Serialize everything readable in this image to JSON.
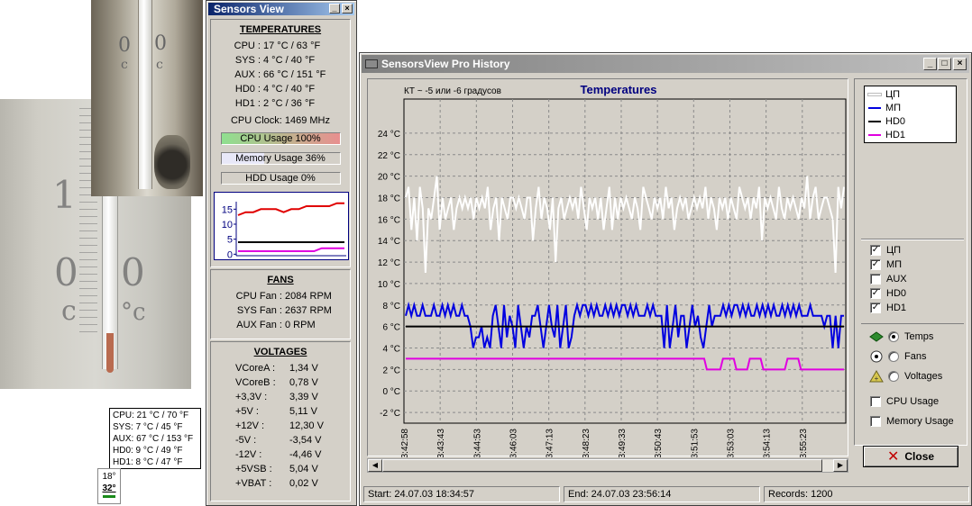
{
  "photos": {
    "left_digits": [
      "1",
      "0",
      "0",
      "c",
      "°c"
    ],
    "top_digits": [
      "0",
      "0",
      "c",
      "c"
    ]
  },
  "tray_tooltip": {
    "lines": [
      "CPU: 21 °C / 70 °F",
      "SYS: 7 °C / 45 °F",
      "AUX: 67 °C / 153 °F",
      "HD0: 9 °C / 49 °F",
      "HD1: 8 °C / 47 °F"
    ]
  },
  "tray_icon": {
    "top": "18°",
    "bottom": "32°"
  },
  "sensors_view": {
    "title": "Sensors View",
    "title_buttons": [
      "_",
      "×"
    ],
    "temperatures": {
      "heading": "TEMPERATURES",
      "rows": [
        {
          "label": "CPU :",
          "value": "17 °C / 63 °F"
        },
        {
          "label": "SYS :",
          "value": "4 °C / 40 °F"
        },
        {
          "label": "AUX :",
          "value": "66 °C / 151 °F"
        },
        {
          "label": "HD0 :",
          "value": "4 °C / 40 °F"
        },
        {
          "label": "HD1 :",
          "value": "2 °C / 36 °F"
        }
      ],
      "cpu_clock": "CPU Clock: 1469 MHz"
    },
    "usage": [
      {
        "label": "CPU Usage 100%",
        "fraction": 1.0,
        "fill": "linear-gradient(90deg,#8fe08f,#e88f8f)"
      },
      {
        "label": "Memory Usage 36%",
        "fraction": 0.36,
        "fill": "#e8e8f8"
      },
      {
        "label": "HDD Usage 0%",
        "fraction": 0.0,
        "fill": "#d4d0c8"
      }
    ],
    "mini_chart": {
      "y_ticks": [
        "15",
        "10",
        "5",
        "0"
      ],
      "series": [
        {
          "name": "CPU",
          "color": "#e00000",
          "values": [
            13,
            14,
            14,
            15,
            15,
            15,
            14,
            15,
            15,
            16,
            16,
            16,
            16,
            17,
            17
          ]
        },
        {
          "name": "HD0",
          "color": "#000000",
          "values": [
            4,
            4,
            4,
            4,
            4,
            4,
            4,
            4,
            4,
            4,
            4,
            4,
            4,
            4,
            4
          ]
        },
        {
          "name": "HD1",
          "color": "#e000e0",
          "values": [
            1,
            1,
            1,
            1,
            1,
            1,
            1,
            1,
            1,
            1,
            1,
            2,
            2,
            2,
            2
          ]
        }
      ]
    },
    "fans": {
      "heading": "FANS",
      "rows": [
        {
          "label": "CPU Fan :",
          "value": "2084 RPM"
        },
        {
          "label": "SYS Fan :",
          "value": "2637 RPM"
        },
        {
          "label": "AUX Fan :",
          "value": "0 RPM"
        }
      ]
    },
    "voltages": {
      "heading": "VOLTAGES",
      "rows": [
        {
          "label": "VCoreA :",
          "value": "1,34 V"
        },
        {
          "label": "VCoreB :",
          "value": "0,78 V"
        },
        {
          "label": "+3,3V :",
          "value": "3,39 V"
        },
        {
          "label": "+5V :",
          "value": "5,11 V"
        },
        {
          "label": "+12V :",
          "value": "12,30 V"
        },
        {
          "label": "-5V :",
          "value": "-3,54 V"
        },
        {
          "label": "-12V :",
          "value": "-4,46 V"
        },
        {
          "label": "+5VSB :",
          "value": "5,04 V"
        },
        {
          "label": "+VBAT :",
          "value": "0,02 V"
        }
      ]
    }
  },
  "history": {
    "title": "SensorsView Pro History",
    "title_buttons": [
      "_",
      "□",
      "×"
    ],
    "annotation": "КТ ~ -5 или -6 градусов",
    "legend": [
      {
        "name": "ЦП",
        "color": "#ffffff"
      },
      {
        "name": "МП",
        "color": "#0000e0"
      },
      {
        "name": "HD0",
        "color": "#000000"
      },
      {
        "name": "HD1",
        "color": "#e000e0"
      }
    ],
    "checkboxes": [
      {
        "label": "ЦП",
        "checked": true
      },
      {
        "label": "МП",
        "checked": true
      },
      {
        "label": "AUX",
        "checked": false
      },
      {
        "label": "HD0",
        "checked": true
      },
      {
        "label": "HD1",
        "checked": true
      }
    ],
    "radios": [
      {
        "label": "Temps",
        "selected": true,
        "icon": "temps-icon"
      },
      {
        "label": "Fans",
        "selected": false,
        "icon": "fan-icon"
      },
      {
        "label": "Voltages",
        "selected": false,
        "icon": "voltage-icon"
      }
    ],
    "extra_checkboxes": [
      {
        "label": "CPU Usage",
        "checked": false
      },
      {
        "label": "Memory Usage",
        "checked": false
      }
    ],
    "close_label": "Close",
    "status": {
      "start": "Start: 24.07.03 18:34:57",
      "end": "End: 24.07.03 23:56:14",
      "records": "Records: 1200"
    }
  },
  "chart_data": {
    "type": "line",
    "title": "Temperatures",
    "xlabel": "",
    "ylabel": "",
    "ylim": [
      -3,
      25
    ],
    "y_ticks": [
      24,
      22,
      20,
      18,
      16,
      14,
      12,
      10,
      8,
      6,
      4,
      2,
      0,
      -2
    ],
    "y_tick_labels": [
      "24 °C",
      "22 °C",
      "20 °C",
      "18 °C",
      "16 °C",
      "14 °C",
      "12 °C",
      "10 °C",
      "8 °C",
      "6 °C",
      "4 °C",
      "2 °C",
      "0 °C",
      "-2 °C"
    ],
    "x_tick_labels": [
      "23:42:58",
      "23:43:43",
      "23:44:53",
      "23:46:03",
      "23:47:13",
      "23:48:23",
      "23:49:33",
      "23:50:43",
      "23:51:53",
      "23:53:03",
      "23:54:13",
      "23:55:23"
    ],
    "grid": true,
    "background": "#d4d0c8",
    "series": [
      {
        "name": "ЦП",
        "color": "#ffffff",
        "values": [
          18,
          19,
          15,
          18,
          14,
          19,
          17,
          11,
          17,
          16,
          18,
          20,
          15,
          18,
          16,
          17,
          18,
          15,
          17,
          18,
          17,
          18,
          17,
          18,
          16,
          18,
          17,
          18,
          17,
          19,
          15,
          17,
          18,
          14,
          18,
          17,
          16,
          18,
          18,
          17,
          18,
          17,
          16,
          18,
          18,
          14,
          17,
          19,
          16,
          18,
          17,
          15,
          18,
          12,
          17,
          18,
          16,
          17,
          18,
          17,
          18,
          16,
          19,
          17,
          15,
          18,
          17,
          18,
          16,
          18,
          15,
          17,
          19,
          15,
          18,
          16,
          18,
          17,
          18,
          17,
          16,
          18,
          17,
          15,
          19,
          18,
          17,
          16,
          18,
          17,
          18,
          16,
          19,
          17,
          18,
          15,
          17,
          18,
          17,
          18,
          16,
          17,
          18,
          17,
          18,
          17,
          19,
          16,
          18,
          17,
          15,
          18,
          17,
          18,
          16,
          18,
          17,
          16,
          19,
          18,
          17,
          18,
          16,
          18,
          17,
          19,
          14,
          18,
          17,
          18,
          17,
          16,
          19,
          17,
          16,
          18,
          17,
          18,
          17,
          16,
          18,
          17,
          20,
          16,
          18,
          19,
          16,
          17,
          18,
          18,
          17,
          16,
          11,
          19,
          17,
          19
        ]
      },
      {
        "name": "МП",
        "color": "#0000e0",
        "values": [
          7,
          8,
          7,
          8,
          7,
          7,
          8,
          7,
          7,
          7,
          8,
          7,
          7,
          8,
          7,
          8,
          7,
          8,
          7,
          7,
          8,
          7,
          7,
          6,
          4,
          5,
          5,
          6,
          4,
          5,
          4,
          7,
          8,
          6,
          4,
          8,
          5,
          7,
          6,
          4,
          8,
          6,
          4,
          6,
          5,
          7,
          7,
          8,
          6,
          4,
          6,
          8,
          6,
          5,
          8,
          4,
          6,
          8,
          4,
          5,
          7,
          8,
          7,
          8,
          8,
          7,
          8,
          7,
          8,
          7,
          7,
          8,
          7,
          8,
          7,
          8,
          7,
          8,
          8,
          7,
          8,
          7,
          8,
          7,
          7,
          7,
          8,
          7,
          8,
          7,
          7,
          7,
          4,
          8,
          4,
          6,
          8,
          5,
          7,
          7,
          4,
          6,
          8,
          6,
          7,
          5,
          4,
          6,
          8,
          6,
          7,
          7,
          7,
          8,
          7,
          8,
          7,
          8,
          8,
          7,
          8,
          7,
          8,
          7,
          7,
          8,
          7,
          8,
          7,
          8,
          7,
          8,
          7,
          7,
          8,
          7,
          8,
          7,
          8,
          7,
          8,
          7,
          7,
          7,
          8,
          7,
          7,
          7,
          7,
          6,
          7,
          7,
          4,
          7,
          4,
          7,
          7
        ]
      },
      {
        "name": "HD0",
        "color": "#000000",
        "values": [
          6,
          6,
          6,
          6,
          6,
          6,
          6,
          6,
          6,
          6,
          6,
          6,
          6,
          6,
          6,
          6,
          6,
          6,
          6,
          6,
          6,
          6,
          6,
          6,
          6,
          6,
          6,
          6,
          6,
          6,
          6,
          6,
          6,
          6,
          6,
          6,
          6,
          6,
          6,
          6,
          6,
          6,
          6,
          6,
          6,
          6,
          6,
          6,
          6,
          6,
          6,
          6,
          6,
          6,
          6,
          6,
          6,
          6,
          6,
          6,
          6,
          6,
          6,
          6,
          6,
          6,
          6,
          6,
          6,
          6,
          6,
          6,
          6,
          6,
          6,
          6,
          6,
          6,
          6,
          6,
          6,
          6,
          6,
          6,
          6,
          6,
          6,
          6,
          6,
          6,
          6,
          6,
          6,
          6,
          6,
          6,
          6,
          6,
          6,
          6,
          6,
          6,
          6,
          6,
          6,
          6,
          6,
          6,
          6,
          6,
          6,
          6,
          6,
          6,
          6,
          6,
          6,
          6,
          6,
          6,
          6,
          6,
          6,
          6,
          6,
          6,
          6,
          6,
          6,
          6,
          6,
          6,
          6,
          6,
          6,
          6,
          6,
          6,
          6,
          6,
          6,
          6,
          6,
          6,
          6,
          6,
          6,
          6,
          6,
          6,
          6,
          6,
          6,
          6,
          6,
          6,
          6
        ]
      },
      {
        "name": "HD1",
        "color": "#e000e0",
        "values": [
          3,
          3,
          3,
          3,
          3,
          3,
          3,
          3,
          3,
          3,
          3,
          3,
          3,
          3,
          3,
          3,
          3,
          3,
          3,
          3,
          3,
          3,
          3,
          3,
          3,
          3,
          3,
          3,
          3,
          3,
          3,
          3,
          3,
          3,
          3,
          3,
          3,
          3,
          3,
          3,
          3,
          3,
          3,
          3,
          3,
          3,
          3,
          3,
          3,
          3,
          3,
          3,
          3,
          3,
          3,
          3,
          3,
          3,
          3,
          3,
          3,
          3,
          3,
          3,
          3,
          3,
          3,
          3,
          3,
          3,
          3,
          3,
          3,
          3,
          3,
          3,
          3,
          3,
          3,
          3,
          3,
          3,
          3,
          3,
          3,
          3,
          3,
          3,
          3,
          3,
          3,
          3,
          3,
          3,
          3,
          3,
          3,
          3,
          3,
          3,
          3,
          3,
          3,
          3,
          3,
          3,
          3,
          3,
          3,
          3,
          3,
          3,
          2,
          2,
          2,
          2,
          2,
          2,
          3,
          3,
          3,
          3,
          3,
          2,
          2,
          2,
          2,
          2,
          3,
          3,
          3,
          3,
          3,
          2,
          2,
          2,
          2,
          2,
          2,
          2,
          2,
          2,
          3,
          3,
          3,
          3,
          3,
          2,
          2,
          2,
          2,
          2,
          2,
          2,
          2,
          2,
          2,
          2,
          2,
          2,
          2,
          2,
          2,
          2
        ]
      }
    ]
  }
}
